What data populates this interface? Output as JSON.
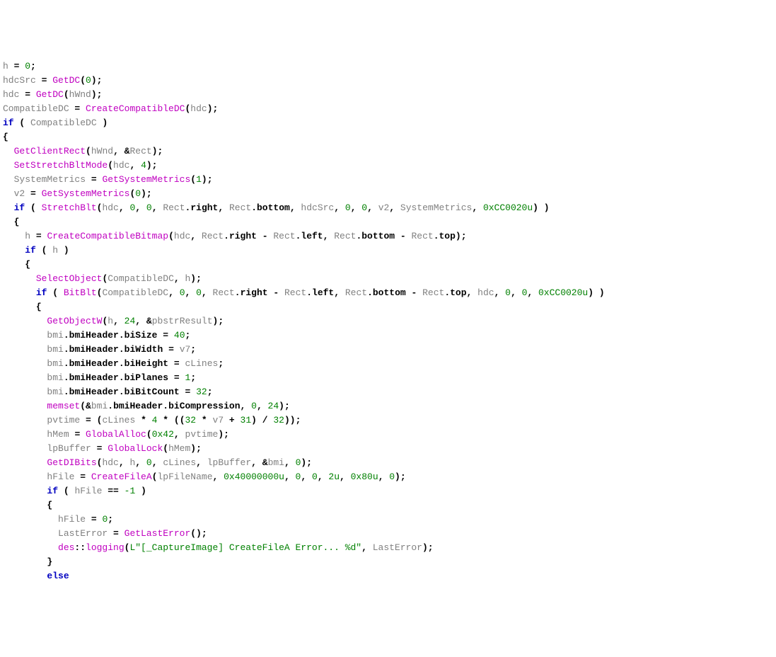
{
  "code": {
    "lines": [
      [
        [
          "var",
          "h"
        ],
        [
          "op",
          " = "
        ],
        [
          "num",
          "0"
        ],
        [
          "op",
          ";"
        ]
      ],
      [
        [
          "var",
          "hdcSrc"
        ],
        [
          "op",
          " = "
        ],
        [
          "func",
          "GetDC"
        ],
        [
          "op",
          "("
        ],
        [
          "num",
          "0"
        ],
        [
          "op",
          ");"
        ]
      ],
      [
        [
          "var",
          "hdc"
        ],
        [
          "op",
          " = "
        ],
        [
          "func",
          "GetDC"
        ],
        [
          "op",
          "("
        ],
        [
          "var",
          "hWnd"
        ],
        [
          "op",
          ");"
        ]
      ],
      [
        [
          "var",
          "CompatibleDC"
        ],
        [
          "op",
          " = "
        ],
        [
          "func",
          "CreateCompatibleDC"
        ],
        [
          "op",
          "("
        ],
        [
          "var",
          "hdc"
        ],
        [
          "op",
          ");"
        ]
      ],
      [
        [
          "kw",
          "if"
        ],
        [
          "op",
          " ( "
        ],
        [
          "var",
          "CompatibleDC"
        ],
        [
          "op",
          " )"
        ]
      ],
      [
        [
          "op",
          "{"
        ]
      ],
      [
        [
          "sp",
          "  "
        ],
        [
          "func",
          "GetClientRect"
        ],
        [
          "op",
          "("
        ],
        [
          "var",
          "hWnd"
        ],
        [
          "op",
          ", &"
        ],
        [
          "var",
          "Rect"
        ],
        [
          "op",
          ");"
        ]
      ],
      [
        [
          "sp",
          "  "
        ],
        [
          "func",
          "SetStretchBltMode"
        ],
        [
          "op",
          "("
        ],
        [
          "var",
          "hdc"
        ],
        [
          "op",
          ", "
        ],
        [
          "num",
          "4"
        ],
        [
          "op",
          ");"
        ]
      ],
      [
        [
          "sp",
          "  "
        ],
        [
          "var",
          "SystemMetrics"
        ],
        [
          "op",
          " = "
        ],
        [
          "func",
          "GetSystemMetrics"
        ],
        [
          "op",
          "("
        ],
        [
          "num",
          "1"
        ],
        [
          "op",
          ");"
        ]
      ],
      [
        [
          "sp",
          "  "
        ],
        [
          "var",
          "v2"
        ],
        [
          "op",
          " = "
        ],
        [
          "func",
          "GetSystemMetrics"
        ],
        [
          "op",
          "("
        ],
        [
          "num",
          "0"
        ],
        [
          "op",
          ");"
        ]
      ],
      [
        [
          "sp",
          "  "
        ],
        [
          "kw",
          "if"
        ],
        [
          "op",
          " ( "
        ],
        [
          "func",
          "StretchBlt"
        ],
        [
          "op",
          "("
        ],
        [
          "var",
          "hdc"
        ],
        [
          "op",
          ", "
        ],
        [
          "num",
          "0"
        ],
        [
          "op",
          ", "
        ],
        [
          "num",
          "0"
        ],
        [
          "op",
          ", "
        ],
        [
          "var",
          "Rect"
        ],
        [
          "op",
          "."
        ],
        [
          "field",
          "right"
        ],
        [
          "op",
          ", "
        ],
        [
          "var",
          "Rect"
        ],
        [
          "op",
          "."
        ],
        [
          "field",
          "bottom"
        ],
        [
          "op",
          ", "
        ],
        [
          "var",
          "hdcSrc"
        ],
        [
          "op",
          ", "
        ],
        [
          "num",
          "0"
        ],
        [
          "op",
          ", "
        ],
        [
          "num",
          "0"
        ],
        [
          "op",
          ", "
        ],
        [
          "var",
          "v2"
        ],
        [
          "op",
          ", "
        ],
        [
          "var",
          "SystemMetrics"
        ],
        [
          "op",
          ", "
        ],
        [
          "num",
          "0xCC0020u"
        ],
        [
          "op",
          ") )"
        ]
      ],
      [
        [
          "sp",
          "  "
        ],
        [
          "op",
          "{"
        ]
      ],
      [
        [
          "sp",
          "    "
        ],
        [
          "var",
          "h"
        ],
        [
          "op",
          " = "
        ],
        [
          "func",
          "CreateCompatibleBitmap"
        ],
        [
          "op",
          "("
        ],
        [
          "var",
          "hdc"
        ],
        [
          "op",
          ", "
        ],
        [
          "var",
          "Rect"
        ],
        [
          "op",
          "."
        ],
        [
          "field",
          "right"
        ],
        [
          "op",
          " - "
        ],
        [
          "var",
          "Rect"
        ],
        [
          "op",
          "."
        ],
        [
          "field",
          "left"
        ],
        [
          "op",
          ", "
        ],
        [
          "var",
          "Rect"
        ],
        [
          "op",
          "."
        ],
        [
          "field",
          "bottom"
        ],
        [
          "op",
          " - "
        ],
        [
          "var",
          "Rect"
        ],
        [
          "op",
          "."
        ],
        [
          "field",
          "top"
        ],
        [
          "op",
          ");"
        ]
      ],
      [
        [
          "sp",
          "    "
        ],
        [
          "kw",
          "if"
        ],
        [
          "op",
          " ( "
        ],
        [
          "var",
          "h"
        ],
        [
          "op",
          " )"
        ]
      ],
      [
        [
          "sp",
          "    "
        ],
        [
          "op",
          "{"
        ]
      ],
      [
        [
          "sp",
          "      "
        ],
        [
          "func",
          "SelectObject"
        ],
        [
          "op",
          "("
        ],
        [
          "var",
          "CompatibleDC"
        ],
        [
          "op",
          ", "
        ],
        [
          "var",
          "h"
        ],
        [
          "op",
          ");"
        ]
      ],
      [
        [
          "sp",
          "      "
        ],
        [
          "kw",
          "if"
        ],
        [
          "op",
          " ( "
        ],
        [
          "func",
          "BitBlt"
        ],
        [
          "op",
          "("
        ],
        [
          "var",
          "CompatibleDC"
        ],
        [
          "op",
          ", "
        ],
        [
          "num",
          "0"
        ],
        [
          "op",
          ", "
        ],
        [
          "num",
          "0"
        ],
        [
          "op",
          ", "
        ],
        [
          "var",
          "Rect"
        ],
        [
          "op",
          "."
        ],
        [
          "field",
          "right"
        ],
        [
          "op",
          " - "
        ],
        [
          "var",
          "Rect"
        ],
        [
          "op",
          "."
        ],
        [
          "field",
          "left"
        ],
        [
          "op",
          ", "
        ],
        [
          "var",
          "Rect"
        ],
        [
          "op",
          "."
        ],
        [
          "field",
          "bottom"
        ],
        [
          "op",
          " - "
        ],
        [
          "var",
          "Rect"
        ],
        [
          "op",
          "."
        ],
        [
          "field",
          "top"
        ],
        [
          "op",
          ", "
        ],
        [
          "var",
          "hdc"
        ],
        [
          "op",
          ", "
        ],
        [
          "num",
          "0"
        ],
        [
          "op",
          ", "
        ],
        [
          "num",
          "0"
        ],
        [
          "op",
          ", "
        ],
        [
          "num",
          "0xCC0020u"
        ],
        [
          "op",
          ") )"
        ]
      ],
      [
        [
          "sp",
          "      "
        ],
        [
          "op",
          "{"
        ]
      ],
      [
        [
          "sp",
          "        "
        ],
        [
          "func",
          "GetObjectW"
        ],
        [
          "op",
          "("
        ],
        [
          "var",
          "h"
        ],
        [
          "op",
          ", "
        ],
        [
          "num",
          "24"
        ],
        [
          "op",
          ", &"
        ],
        [
          "var",
          "pbstrResult"
        ],
        [
          "op",
          ");"
        ]
      ],
      [
        [
          "sp",
          "        "
        ],
        [
          "var",
          "bmi"
        ],
        [
          "op",
          "."
        ],
        [
          "field",
          "bmiHeader"
        ],
        [
          "op",
          "."
        ],
        [
          "field",
          "biSize"
        ],
        [
          "op",
          " = "
        ],
        [
          "num",
          "40"
        ],
        [
          "op",
          ";"
        ]
      ],
      [
        [
          "sp",
          "        "
        ],
        [
          "var",
          "bmi"
        ],
        [
          "op",
          "."
        ],
        [
          "field",
          "bmiHeader"
        ],
        [
          "op",
          "."
        ],
        [
          "field",
          "biWidth"
        ],
        [
          "op",
          " = "
        ],
        [
          "var",
          "v7"
        ],
        [
          "op",
          ";"
        ]
      ],
      [
        [
          "sp",
          "        "
        ],
        [
          "var",
          "bmi"
        ],
        [
          "op",
          "."
        ],
        [
          "field",
          "bmiHeader"
        ],
        [
          "op",
          "."
        ],
        [
          "field",
          "biHeight"
        ],
        [
          "op",
          " = "
        ],
        [
          "var",
          "cLines"
        ],
        [
          "op",
          ";"
        ]
      ],
      [
        [
          "sp",
          "        "
        ],
        [
          "var",
          "bmi"
        ],
        [
          "op",
          "."
        ],
        [
          "field",
          "bmiHeader"
        ],
        [
          "op",
          "."
        ],
        [
          "field",
          "biPlanes"
        ],
        [
          "op",
          " = "
        ],
        [
          "num",
          "1"
        ],
        [
          "op",
          ";"
        ]
      ],
      [
        [
          "sp",
          "        "
        ],
        [
          "var",
          "bmi"
        ],
        [
          "op",
          "."
        ],
        [
          "field",
          "bmiHeader"
        ],
        [
          "op",
          "."
        ],
        [
          "field",
          "biBitCount"
        ],
        [
          "op",
          " = "
        ],
        [
          "num",
          "32"
        ],
        [
          "op",
          ";"
        ]
      ],
      [
        [
          "sp",
          "        "
        ],
        [
          "func",
          "memset"
        ],
        [
          "op",
          "(&"
        ],
        [
          "var",
          "bmi"
        ],
        [
          "op",
          "."
        ],
        [
          "field",
          "bmiHeader"
        ],
        [
          "op",
          "."
        ],
        [
          "field",
          "biCompression"
        ],
        [
          "op",
          ", "
        ],
        [
          "num",
          "0"
        ],
        [
          "op",
          ", "
        ],
        [
          "num",
          "24"
        ],
        [
          "op",
          ");"
        ]
      ],
      [
        [
          "sp",
          "        "
        ],
        [
          "var",
          "pvtime"
        ],
        [
          "op",
          " = ("
        ],
        [
          "var",
          "cLines"
        ],
        [
          "op",
          " * "
        ],
        [
          "num",
          "4"
        ],
        [
          "op",
          " * (("
        ],
        [
          "num",
          "32"
        ],
        [
          "op",
          " * "
        ],
        [
          "var",
          "v7"
        ],
        [
          "op",
          " + "
        ],
        [
          "num",
          "31"
        ],
        [
          "op",
          ") / "
        ],
        [
          "num",
          "32"
        ],
        [
          "op",
          "));"
        ]
      ],
      [
        [
          "sp",
          "        "
        ],
        [
          "var",
          "hMem"
        ],
        [
          "op",
          " = "
        ],
        [
          "func",
          "GlobalAlloc"
        ],
        [
          "op",
          "("
        ],
        [
          "num",
          "0x42"
        ],
        [
          "op",
          ", "
        ],
        [
          "var",
          "pvtime"
        ],
        [
          "op",
          ");"
        ]
      ],
      [
        [
          "sp",
          "        "
        ],
        [
          "var",
          "lpBuffer"
        ],
        [
          "op",
          " = "
        ],
        [
          "func",
          "GlobalLock"
        ],
        [
          "op",
          "("
        ],
        [
          "var",
          "hMem"
        ],
        [
          "op",
          ");"
        ]
      ],
      [
        [
          "sp",
          "        "
        ],
        [
          "func",
          "GetDIBits"
        ],
        [
          "op",
          "("
        ],
        [
          "var",
          "hdc"
        ],
        [
          "op",
          ", "
        ],
        [
          "var",
          "h"
        ],
        [
          "op",
          ", "
        ],
        [
          "num",
          "0"
        ],
        [
          "op",
          ", "
        ],
        [
          "var",
          "cLines"
        ],
        [
          "op",
          ", "
        ],
        [
          "var",
          "lpBuffer"
        ],
        [
          "op",
          ", &"
        ],
        [
          "var",
          "bmi"
        ],
        [
          "op",
          ", "
        ],
        [
          "num",
          "0"
        ],
        [
          "op",
          ");"
        ]
      ],
      [
        [
          "sp",
          "        "
        ],
        [
          "var",
          "hFile"
        ],
        [
          "op",
          " = "
        ],
        [
          "func",
          "CreateFileA"
        ],
        [
          "op",
          "("
        ],
        [
          "var",
          "lpFileName"
        ],
        [
          "op",
          ", "
        ],
        [
          "num",
          "0x40000000u"
        ],
        [
          "op",
          ", "
        ],
        [
          "num",
          "0"
        ],
        [
          "op",
          ", "
        ],
        [
          "num",
          "0"
        ],
        [
          "op",
          ", "
        ],
        [
          "num",
          "2u"
        ],
        [
          "op",
          ", "
        ],
        [
          "num",
          "0x80u"
        ],
        [
          "op",
          ", "
        ],
        [
          "num",
          "0"
        ],
        [
          "op",
          ");"
        ]
      ],
      [
        [
          "sp",
          "        "
        ],
        [
          "kw",
          "if"
        ],
        [
          "op",
          " ( "
        ],
        [
          "var",
          "hFile"
        ],
        [
          "op",
          " == "
        ],
        [
          "num",
          "-1"
        ],
        [
          "op",
          " )"
        ]
      ],
      [
        [
          "sp",
          "        "
        ],
        [
          "op",
          "{"
        ]
      ],
      [
        [
          "sp",
          "          "
        ],
        [
          "var",
          "hFile"
        ],
        [
          "op",
          " = "
        ],
        [
          "num",
          "0"
        ],
        [
          "op",
          ";"
        ]
      ],
      [
        [
          "sp",
          "          "
        ],
        [
          "var",
          "LastError"
        ],
        [
          "op",
          " = "
        ],
        [
          "func",
          "GetLastError"
        ],
        [
          "op",
          "();"
        ]
      ],
      [
        [
          "sp",
          "          "
        ],
        [
          "func",
          "des"
        ],
        [
          "op",
          "::"
        ],
        [
          "func",
          "logging"
        ],
        [
          "op",
          "("
        ],
        [
          "str",
          "L\"[_CaptureImage] CreateFileA Error... %d\""
        ],
        [
          "op",
          ", "
        ],
        [
          "var",
          "LastError"
        ],
        [
          "op",
          ");"
        ]
      ],
      [
        [
          "sp",
          "        "
        ],
        [
          "op",
          "}"
        ]
      ],
      [
        [
          "sp",
          "        "
        ],
        [
          "kw",
          "else"
        ]
      ]
    ]
  }
}
